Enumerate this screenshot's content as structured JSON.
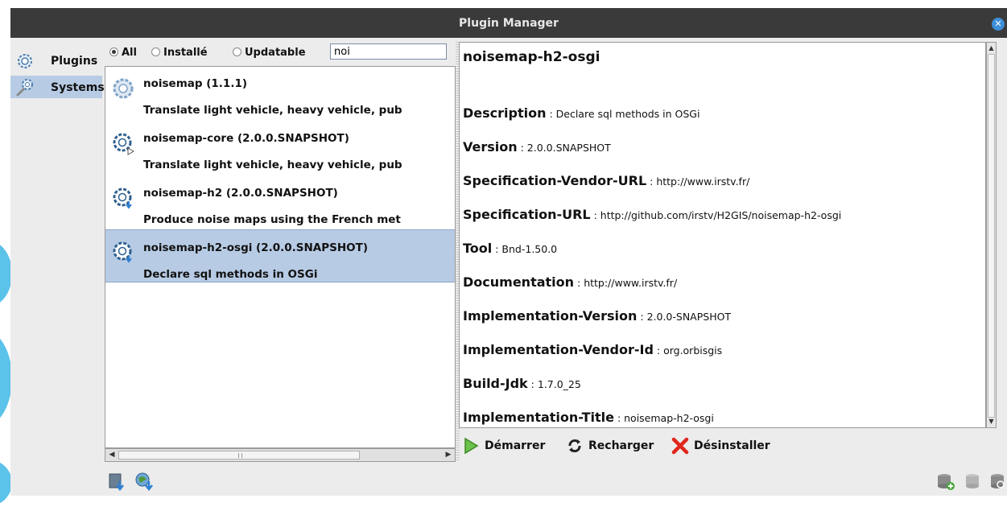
{
  "window": {
    "title": "Plugin Manager",
    "close_icon": "close-icon"
  },
  "sidebar": {
    "items": [
      {
        "label": "Plugins",
        "icon": "gear-icon",
        "selected": false
      },
      {
        "label": "Systems",
        "icon": "wrench-gear-icon",
        "selected": true
      }
    ]
  },
  "filter": {
    "options": [
      {
        "label": "All",
        "checked": true
      },
      {
        "label": "Installé",
        "checked": false
      },
      {
        "label": "Updatable",
        "checked": false
      }
    ],
    "search_value": "noi"
  },
  "plugins": [
    {
      "name": "noisemap (1.1.1)",
      "desc": "Translate light vehicle, heavy vehicle, pub",
      "selected": false
    },
    {
      "name": "noisemap-core (2.0.0.SNAPSHOT)",
      "desc": "Translate light vehicle, heavy vehicle, pub",
      "selected": false
    },
    {
      "name": "noisemap-h2 (2.0.0.SNAPSHOT)",
      "desc": "Produce noise maps using the French met",
      "selected": false
    },
    {
      "name": "noisemap-h2-osgi (2.0.0.SNAPSHOT)",
      "desc": "Declare sql methods in OSGi",
      "selected": true
    }
  ],
  "details": {
    "title": "noisemap-h2-osgi",
    "props": [
      {
        "key": "Description",
        "value": " : Declare sql methods in OSGi"
      },
      {
        "key": "Version",
        "value": " : 2.0.0.SNAPSHOT"
      },
      {
        "key": "Specification-Vendor-URL",
        "value": " : http://www.irstv.fr/"
      },
      {
        "key": "Specification-URL",
        "value": " : http://github.com/irstv/H2GIS/noisemap-h2-osgi"
      },
      {
        "key": "Tool",
        "value": " : Bnd-1.50.0"
      },
      {
        "key": "Documentation",
        "value": " : http://www.irstv.fr/"
      },
      {
        "key": "Implementation-Version",
        "value": " : 2.0.0-SNAPSHOT"
      },
      {
        "key": "Implementation-Vendor-Id",
        "value": " : org.orbisgis"
      },
      {
        "key": "Build-Jdk",
        "value": " : 1.7.0_25"
      },
      {
        "key": "Implementation-Title",
        "value": " : noisemap-h2-osgi"
      }
    ]
  },
  "actions": {
    "start": "Démarrer",
    "reload": "Recharger",
    "uninstall": "Désinstaller"
  },
  "colors": {
    "selection": "#b7cbe4",
    "titlebar": "#3a3a3a",
    "close": "#3d8fd8",
    "desktop_accent": "#5bc2ea"
  }
}
